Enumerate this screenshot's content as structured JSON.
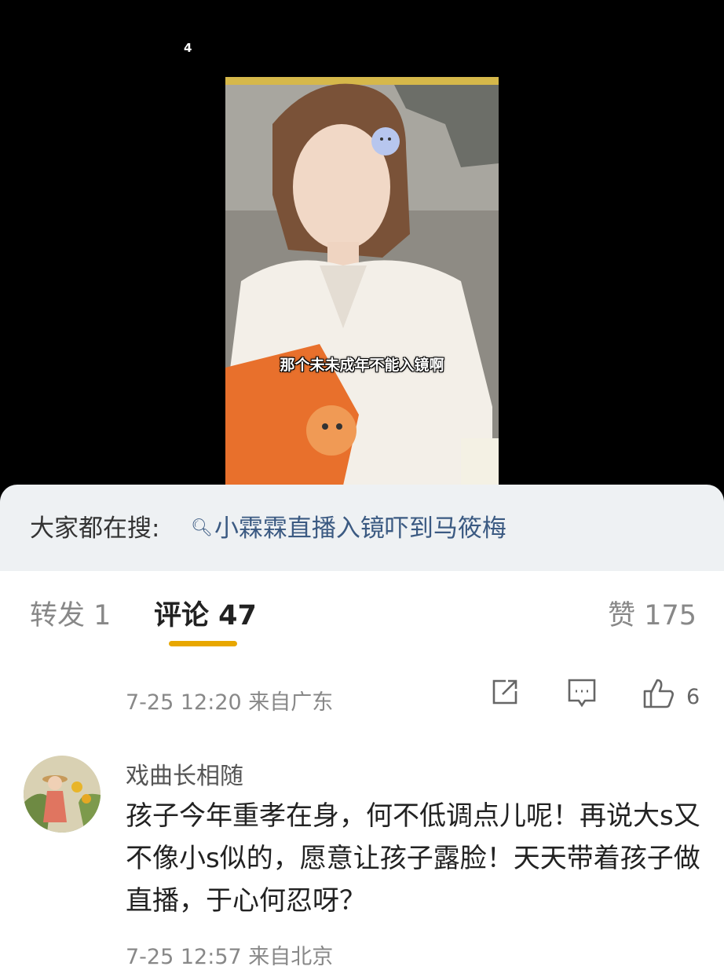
{
  "video": {
    "page_indicator": "4",
    "subtitle": "那个未未成年不能入镜啊"
  },
  "search": {
    "prefix": "大家都在搜:",
    "query": "小霖霖直播入镜吓到马筱梅"
  },
  "tabs": {
    "repost": "转发 1",
    "comments": "评论 47",
    "likes": "赞 175"
  },
  "prev_comment": {
    "time_location": "7-25 12:20 来自广东",
    "like_count": "6"
  },
  "comment": {
    "username": "戏曲长相随",
    "text": "孩子今年重孝在身，何不低调点儿呢！再说大s又不像小s似的，愿意让孩子露脸！天天带着孩子做直播，于心何忍呀？"
  },
  "next_comment": {
    "time_location": "7-25 12:57 来自北京"
  },
  "icons": [
    "search-icon",
    "share-icon",
    "comment-icon",
    "thumbs-up-icon"
  ]
}
